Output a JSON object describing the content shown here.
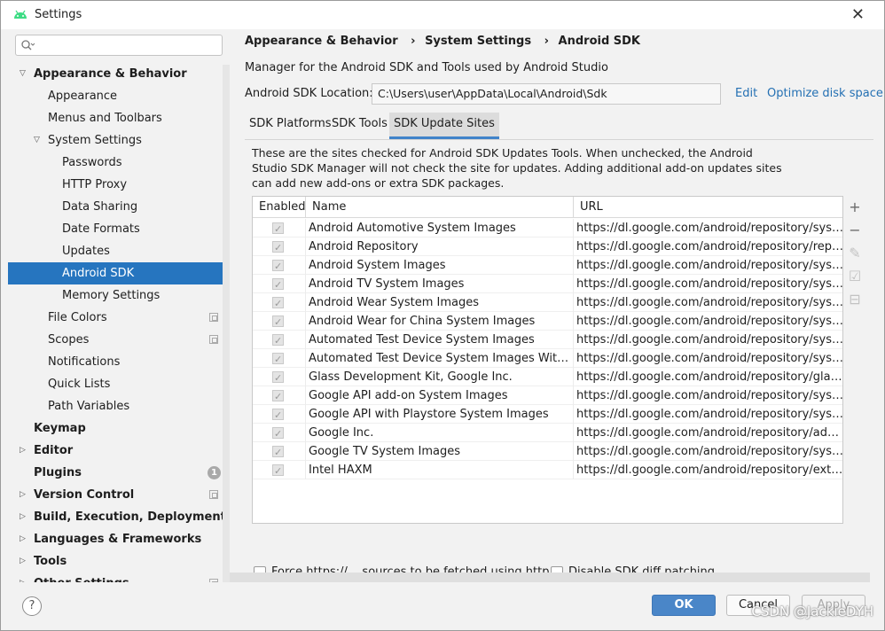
{
  "window": {
    "title": "Settings"
  },
  "search": {
    "placeholder": ""
  },
  "tree": [
    {
      "label": "Appearance & Behavior",
      "bold": true,
      "arrow": "down",
      "indent": 0
    },
    {
      "label": "Appearance",
      "indent": 1
    },
    {
      "label": "Menus and Toolbars",
      "indent": 1
    },
    {
      "label": "System Settings",
      "arrow": "down",
      "indent": 1
    },
    {
      "label": "Passwords",
      "indent": 2
    },
    {
      "label": "HTTP Proxy",
      "indent": 2
    },
    {
      "label": "Data Sharing",
      "indent": 2
    },
    {
      "label": "Date Formats",
      "indent": 2
    },
    {
      "label": "Updates",
      "indent": 2
    },
    {
      "label": "Android SDK",
      "indent": 2,
      "selected": true
    },
    {
      "label": "Memory Settings",
      "indent": 2
    },
    {
      "label": "File Colors",
      "indent": 1,
      "icon": "copy-icon"
    },
    {
      "label": "Scopes",
      "indent": 1,
      "icon": "copy-icon"
    },
    {
      "label": "Notifications",
      "indent": 1
    },
    {
      "label": "Quick Lists",
      "indent": 1
    },
    {
      "label": "Path Variables",
      "indent": 1
    },
    {
      "label": "Keymap",
      "bold": true,
      "indent": 0
    },
    {
      "label": "Editor",
      "bold": true,
      "arrow": "right",
      "indent": 0
    },
    {
      "label": "Plugins",
      "bold": true,
      "indent": 0,
      "badge": "1"
    },
    {
      "label": "Version Control",
      "bold": true,
      "arrow": "right",
      "indent": 0,
      "icon": "copy-icon"
    },
    {
      "label": "Build, Execution, Deployment",
      "bold": true,
      "arrow": "right",
      "indent": 0
    },
    {
      "label": "Languages & Frameworks",
      "bold": true,
      "arrow": "right",
      "indent": 0
    },
    {
      "label": "Tools",
      "bold": true,
      "arrow": "right",
      "indent": 0
    },
    {
      "label": "Other Settings",
      "bold": true,
      "arrow": "right",
      "indent": 0,
      "icon": "copy-icon"
    }
  ],
  "breadcrumb": [
    "Appearance & Behavior",
    "System Settings",
    "Android SDK"
  ],
  "description": "Manager for the Android SDK and Tools used by Android Studio",
  "sdk_location": {
    "label": "Android SDK Location:",
    "value": "C:\\Users\\user\\AppData\\Local\\Android\\Sdk",
    "edit": "Edit",
    "optimize": "Optimize disk space"
  },
  "tabs": [
    "SDK Platforms",
    "SDK Tools",
    "SDK Update Sites"
  ],
  "active_tab": "SDK Update Sites",
  "info_text": "These are the sites checked for Android SDK Updates Tools. When unchecked, the Android Studio SDK Manager will not check the site for updates. Adding additional add-on updates sites can add new add-ons or extra SDK packages.",
  "table": {
    "headers": [
      "Enabled",
      "Name",
      "URL"
    ],
    "rows": [
      {
        "enabled": true,
        "name": "Android Automotive System Images",
        "url": "https://dl.google.com/android/repository/sys-im…"
      },
      {
        "enabled": true,
        "name": "Android Repository",
        "url": "https://dl.google.com/android/repository/reposi…"
      },
      {
        "enabled": true,
        "name": "Android System Images",
        "url": "https://dl.google.com/android/repository/sys-im…"
      },
      {
        "enabled": true,
        "name": "Android TV System Images",
        "url": "https://dl.google.com/android/repository/sys-im…"
      },
      {
        "enabled": true,
        "name": "Android Wear System Images",
        "url": "https://dl.google.com/android/repository/sys-im…"
      },
      {
        "enabled": true,
        "name": "Android Wear for China System Images",
        "url": "https://dl.google.com/android/repository/sys-im…"
      },
      {
        "enabled": true,
        "name": "Automated Test Device System Images",
        "url": "https://dl.google.com/android/repository/sys-im…"
      },
      {
        "enabled": true,
        "name": "Automated Test Device System Images With Goo…",
        "url": "https://dl.google.com/android/repository/sys-im…"
      },
      {
        "enabled": true,
        "name": "Glass Development Kit, Google Inc.",
        "url": "https://dl.google.com/android/repository/glass/…"
      },
      {
        "enabled": true,
        "name": "Google API add-on System Images",
        "url": "https://dl.google.com/android/repository/sys-im…"
      },
      {
        "enabled": true,
        "name": "Google API with Playstore System Images",
        "url": "https://dl.google.com/android/repository/sys-im…"
      },
      {
        "enabled": true,
        "name": "Google Inc.",
        "url": "https://dl.google.com/android/repository/addon…"
      },
      {
        "enabled": true,
        "name": "Google TV System Images",
        "url": "https://dl.google.com/android/repository/sys-im…"
      },
      {
        "enabled": true,
        "name": "Intel HAXM",
        "url": "https://dl.google.com/android/repository/extras/…"
      }
    ]
  },
  "table_toolbar": [
    {
      "icon": "add-icon",
      "glyph": "+",
      "enabled": true
    },
    {
      "icon": "remove-icon",
      "glyph": "−",
      "enabled": true
    },
    {
      "icon": "edit-icon",
      "glyph": "✎",
      "enabled": false
    },
    {
      "icon": "check-all-icon",
      "glyph": "☑",
      "enabled": false
    },
    {
      "icon": "uncheck-all-icon",
      "glyph": "⊟",
      "enabled": false
    }
  ],
  "options": {
    "force_https": "Force https://... sources to be fetched using http://...",
    "disable_diff": "Disable SDK diff patching"
  },
  "buttons": {
    "help": "?",
    "ok": "OK",
    "cancel": "Cancel",
    "apply": "Apply"
  },
  "watermark": "CSDN @JackieDYH",
  "colors": {
    "selected": "#2675bf",
    "link": "#2470b3",
    "ok": "#4a86c8",
    "tab_underline": "#4083c9"
  }
}
